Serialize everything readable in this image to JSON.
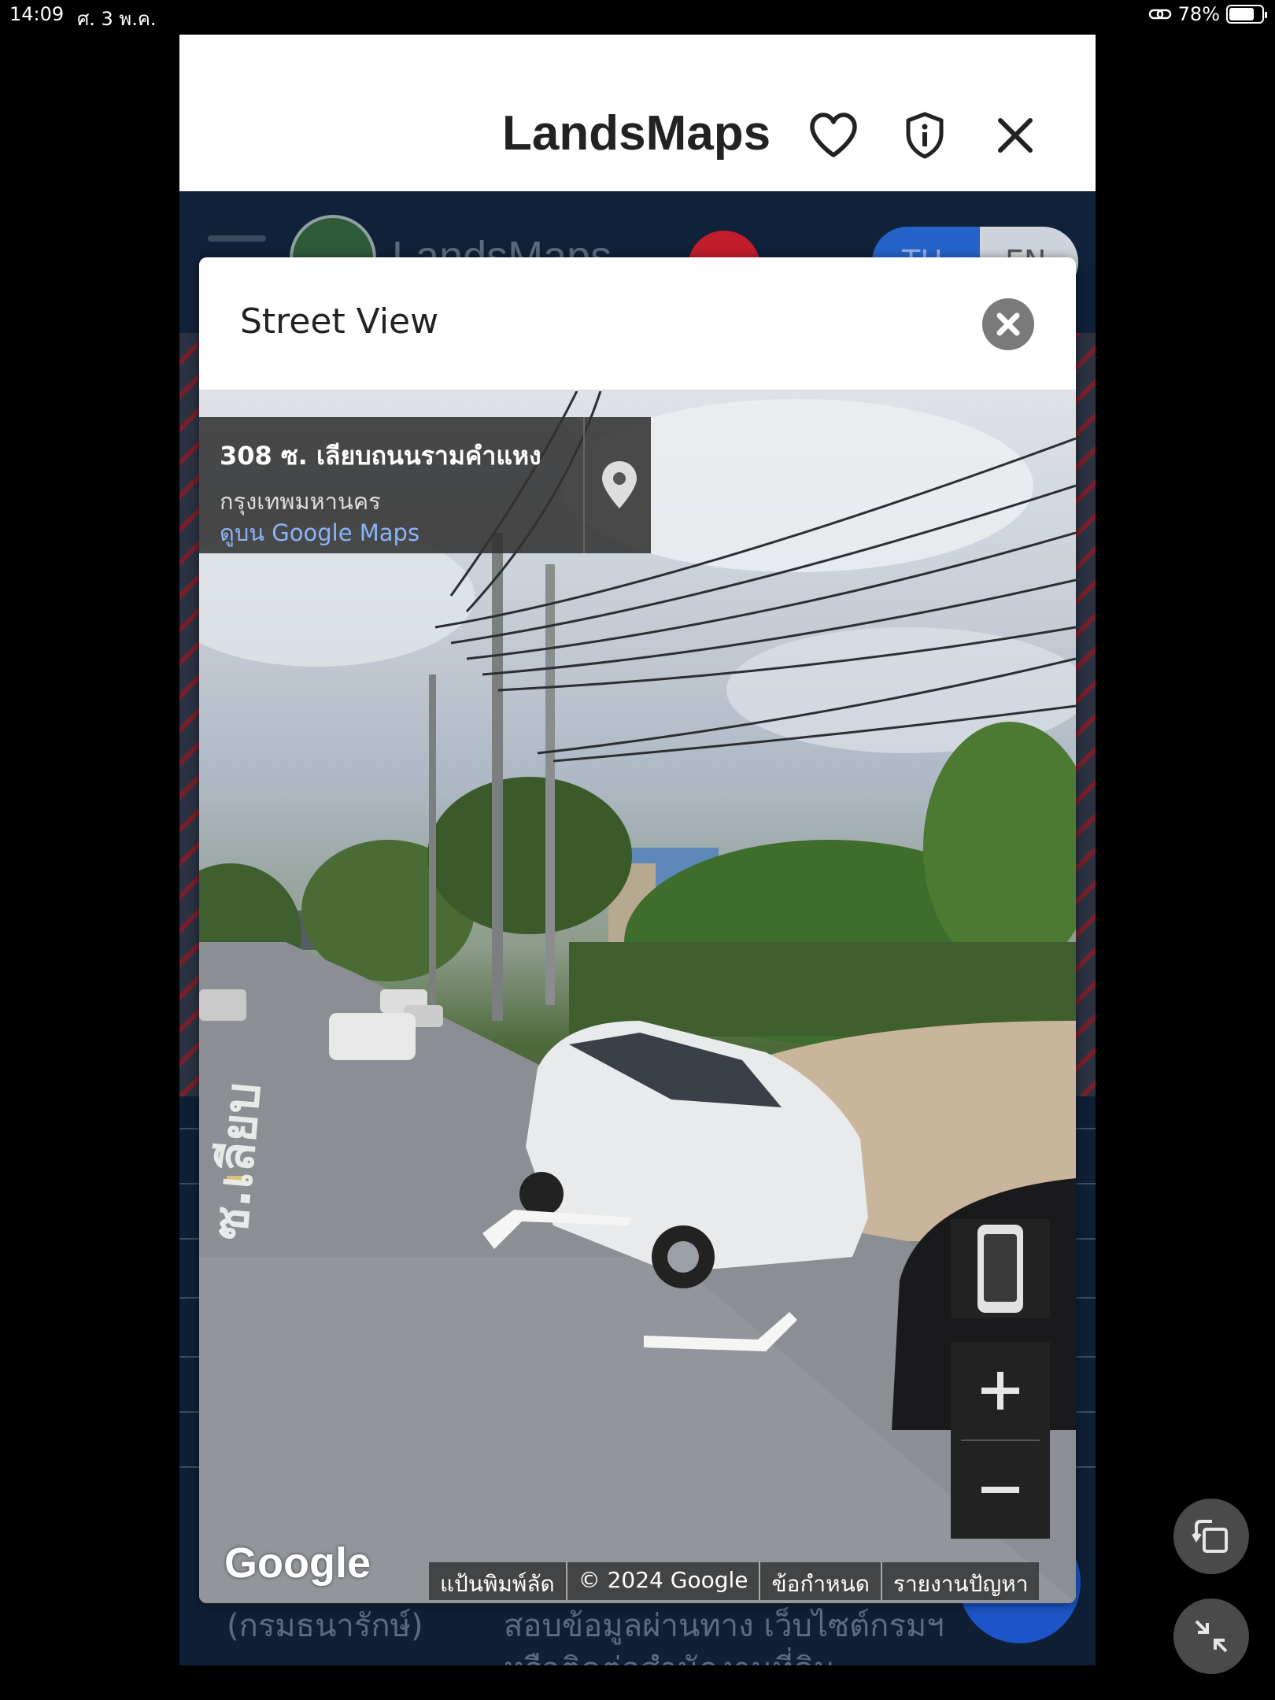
{
  "status_bar": {
    "time": "14:09",
    "date": "ศ. 3 พ.ค.",
    "battery": "78%",
    "battery_level": 0.78
  },
  "sheet": {
    "title": "LandsMaps",
    "favorite_icon": "heart-icon",
    "info_icon": "shield-info-icon",
    "close_icon": "close-icon"
  },
  "background_page": {
    "brand": "LandsMaps",
    "lang_th": "TH",
    "lang_en": "EN",
    "footer_text_1": "(กรมธนารักษ์)",
    "footer_text_2": "สอบข้อมูลผ่านทาง เว็บไซต์กรมฯ",
    "footer_text_3": "หรือติดต่อสำนักงานที่ดิน"
  },
  "modal": {
    "title": "Street View",
    "close_icon": "close-circle-icon"
  },
  "street_view": {
    "address": "308 ซ. เลียบถนนรามคำแหง",
    "city": "กรุงเทพมหานคร",
    "maps_link": "ดูบน Google Maps",
    "pin_icon": "location-pin-icon",
    "pegman_icon": "device-rotate-icon",
    "zoom_in_icon": "plus-icon",
    "zoom_out_icon": "minus-icon",
    "google_logo": "Google",
    "attribution": {
      "shortcuts": "แป้นพิมพ์ลัด",
      "copyright": "© 2024 Google",
      "terms": "ข้อกำหนด",
      "report": "รายงานปัญหา"
    }
  },
  "floating": {
    "rotate_icon": "rotate-icon",
    "minimize_icon": "minimize-icon"
  }
}
